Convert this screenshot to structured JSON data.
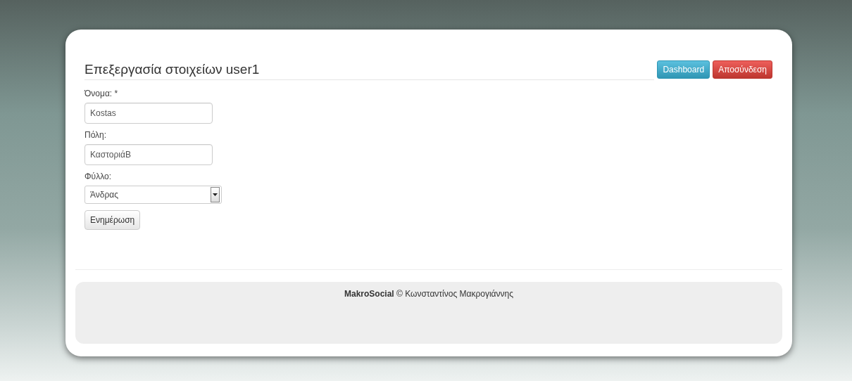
{
  "header": {
    "title": "Επεξεργασία στοιχείων user1",
    "buttons": [
      {
        "label": "Dashboard",
        "kind": "info"
      },
      {
        "label": "Αποσύνδεση",
        "kind": "danger"
      }
    ]
  },
  "form": {
    "fields": [
      {
        "label": "Όνομα: *",
        "kind": "text",
        "value": "Kostas"
      },
      {
        "label": "Πόλη:",
        "kind": "text",
        "value": "ΚαστοριάΒ"
      },
      {
        "label": "Φύλλο:",
        "kind": "select",
        "value": "Άνδρας"
      }
    ],
    "submit": "Ενημέρωση"
  },
  "footer": {
    "text": "**MakroSocial** © Κωνσταντίνος Μακρογιάννης"
  }
}
